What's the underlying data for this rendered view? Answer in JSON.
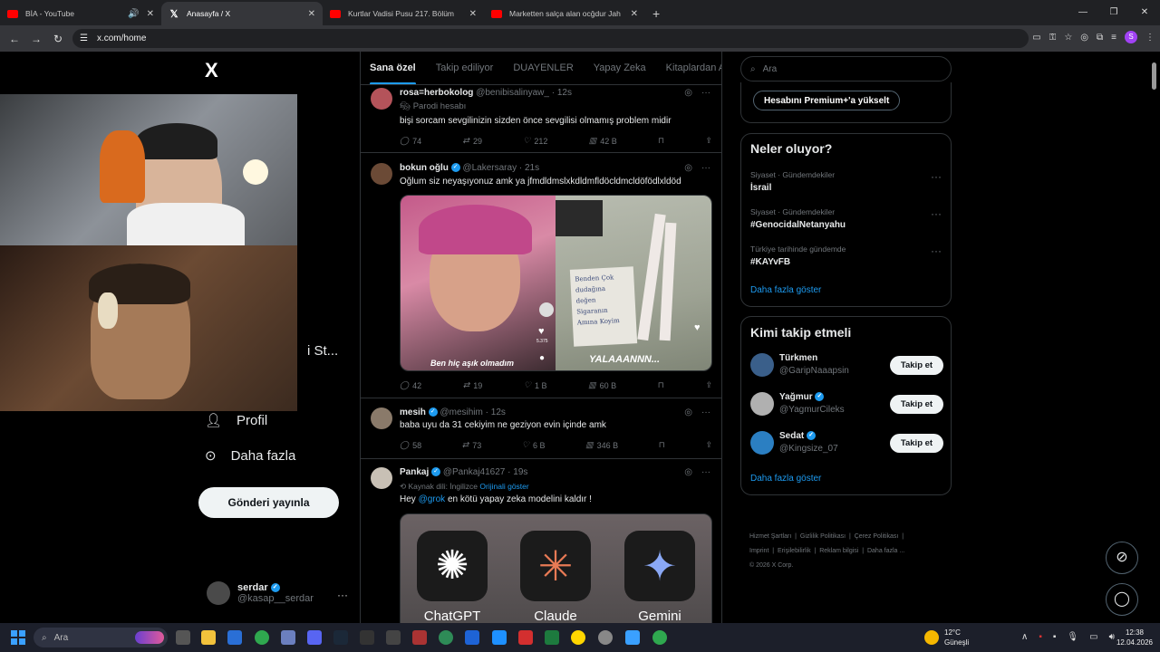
{
  "browser": {
    "tabs": [
      {
        "title": "BİA - YouTube",
        "favicon": "youtube-icon",
        "active": false
      },
      {
        "title": "Anasayfa / X",
        "favicon": "x-icon",
        "active": true
      },
      {
        "title": "Kurtlar Vadisi Pusu 217. Bölüm",
        "favicon": "youtube-icon",
        "active": false
      },
      {
        "title": "Marketten salça alan ocğdur Jah",
        "favicon": "youtube-icon",
        "active": false
      }
    ],
    "url": "x.com/home"
  },
  "left": {
    "logo": "X",
    "partial_label": "i St...",
    "nav": [
      {
        "label": "Profil",
        "icon": "person-icon"
      },
      {
        "label": "Daha fazla",
        "icon": "more-circle-icon"
      }
    ],
    "post_button": "Gönderi yayınla",
    "user": {
      "name": "serdar",
      "handle": "@kasap__serdar"
    }
  },
  "feed": {
    "tabs": [
      "Sana özel",
      "Takip ediliyor",
      "DUAYENLER",
      "Yapay Zeka",
      "Kitaplardan Alıntı"
    ],
    "tweets": [
      {
        "name": "rosa=herbokolog",
        "handle": "@benibisalinyaw_",
        "time": "12s",
        "sub": "Parodi hesabı",
        "text": "bişi sorcam sevgilinizin sizden önce sevgilisi olmamış problem midir",
        "replies": "74",
        "reposts": "29",
        "likes": "212",
        "views": "42 B"
      },
      {
        "name": "bokun oğlu",
        "handle": "@Lakersaray",
        "time": "21s",
        "text": "Oğlum siz neyaşıyonuz amk ya jfmdldmslxkdldmfldöcldmcldöfödlxldöd",
        "caption_left": "Ben hiç aşık olmadım",
        "caption_right": "YALAAANNN...",
        "note_lines": [
          "Benden Çok",
          "dudağına",
          "değen",
          "Sigaranın",
          "Amına Koyim"
        ],
        "side_count": "5.375",
        "replies": "42",
        "reposts": "19",
        "likes": "1 B",
        "views": "60 B"
      },
      {
        "name": "mesih",
        "handle": "@mesihim",
        "time": "12s",
        "text": "baba uyu da 31 cekiyim ne geziyon evin içinde amk",
        "replies": "58",
        "reposts": "73",
        "likes": "6 B",
        "views": "346 B"
      },
      {
        "name": "Pankaj",
        "handle": "@Pankaj41627",
        "time": "19s",
        "sub_prefix": "Kaynak dili: İngilizce",
        "sub_link": "Orijinali göster",
        "text_prefix": "Hey",
        "mention": "@grok",
        "text_suffix": "en kötü yapay zeka modelini kaldır !",
        "apps": [
          "ChatGPT",
          "Claude",
          "Gemini"
        ]
      }
    ]
  },
  "right": {
    "search_placeholder": "Ara",
    "premium": "Hesabını Premium+'a yükselt",
    "trends_title": "Neler oluyor?",
    "trends": [
      {
        "context": "Siyaset · Gündemdekiler",
        "topic": "İsrail"
      },
      {
        "context": "Siyaset · Gündemdekiler",
        "topic": "#GenocidalNetanyahu"
      },
      {
        "context": "Türkiye tarihinde gündemde",
        "topic": "#KAYvFB"
      }
    ],
    "show_more": "Daha fazla göster",
    "who_title": "Kimi takip etmeli",
    "who": [
      {
        "name": "Türkmen",
        "handle": "@GaripNaaapsin",
        "verified": false
      },
      {
        "name": "Yağmur",
        "handle": "@YagmurCileks",
        "verified": true
      },
      {
        "name": "Sedat",
        "handle": "@Kingsize_07",
        "verified": true
      }
    ],
    "follow_label": "Takip et",
    "footer": [
      "Hizmet Şartları",
      "Gizlilik Politikası",
      "Çerez Politikası",
      "Imprint",
      "Erişilebilirlik",
      "Reklam bilgisi",
      "Daha fazla ...",
      "© 2026 X Corp."
    ]
  },
  "taskbar": {
    "search": "Ara",
    "weather_temp": "12°C",
    "weather_text": "Güneşli",
    "time": "12:38",
    "date": "12.04.2026"
  },
  "colors": {
    "accent": "#1d9bf0",
    "bg": "#000000",
    "border": "#2f3336"
  }
}
